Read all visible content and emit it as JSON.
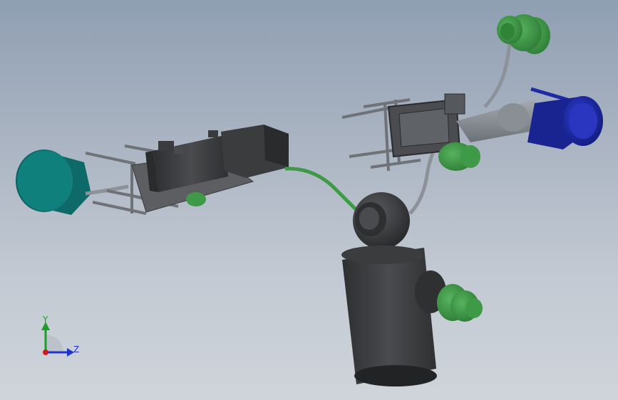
{
  "viewport": {
    "background_top": "#8f9fb2",
    "background_bottom": "#cfd4da"
  },
  "model": {
    "colors": {
      "teal_motor": "#0f7674",
      "dark_body": "#3f4042",
      "green_part": "#3f9a47",
      "blue_motor": "#1f2aa6",
      "cable_gray": "#8c919a",
      "frame_gray": "#6f7276"
    }
  },
  "triad": {
    "y_label": "Y",
    "z_label": "Z",
    "x_color": "#c81e1e",
    "y_color": "#1f9d2a",
    "z_color": "#2233cc"
  }
}
